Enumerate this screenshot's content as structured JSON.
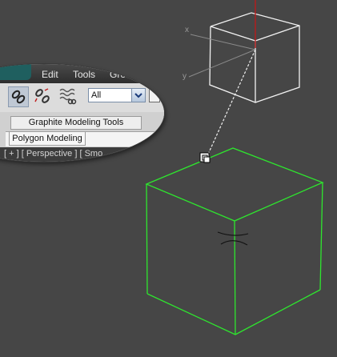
{
  "menu": {
    "items": [
      {
        "label": "Edit"
      },
      {
        "label": "Tools"
      },
      {
        "label": "Gro"
      }
    ]
  },
  "toolbar": {
    "icons": [
      "link-icon",
      "unlink-icon",
      "bind-to-space-warp-icon"
    ],
    "selection_filter": {
      "value": "All"
    }
  },
  "ribbon": {
    "tab_label": "Graphite Modeling Tools",
    "panel_label": "Polygon Modeling"
  },
  "viewport": {
    "label": "[ + ] [ Perspective ] [ Smo"
  },
  "scene": {
    "target_axis_labels": [
      "x",
      "y"
    ],
    "colors": {
      "background": "#464646",
      "target_wire": "#f0f0f0",
      "selected_wire": "#2ee62e",
      "z_axis": "#c01818",
      "pivot_mark": "#111111"
    }
  }
}
